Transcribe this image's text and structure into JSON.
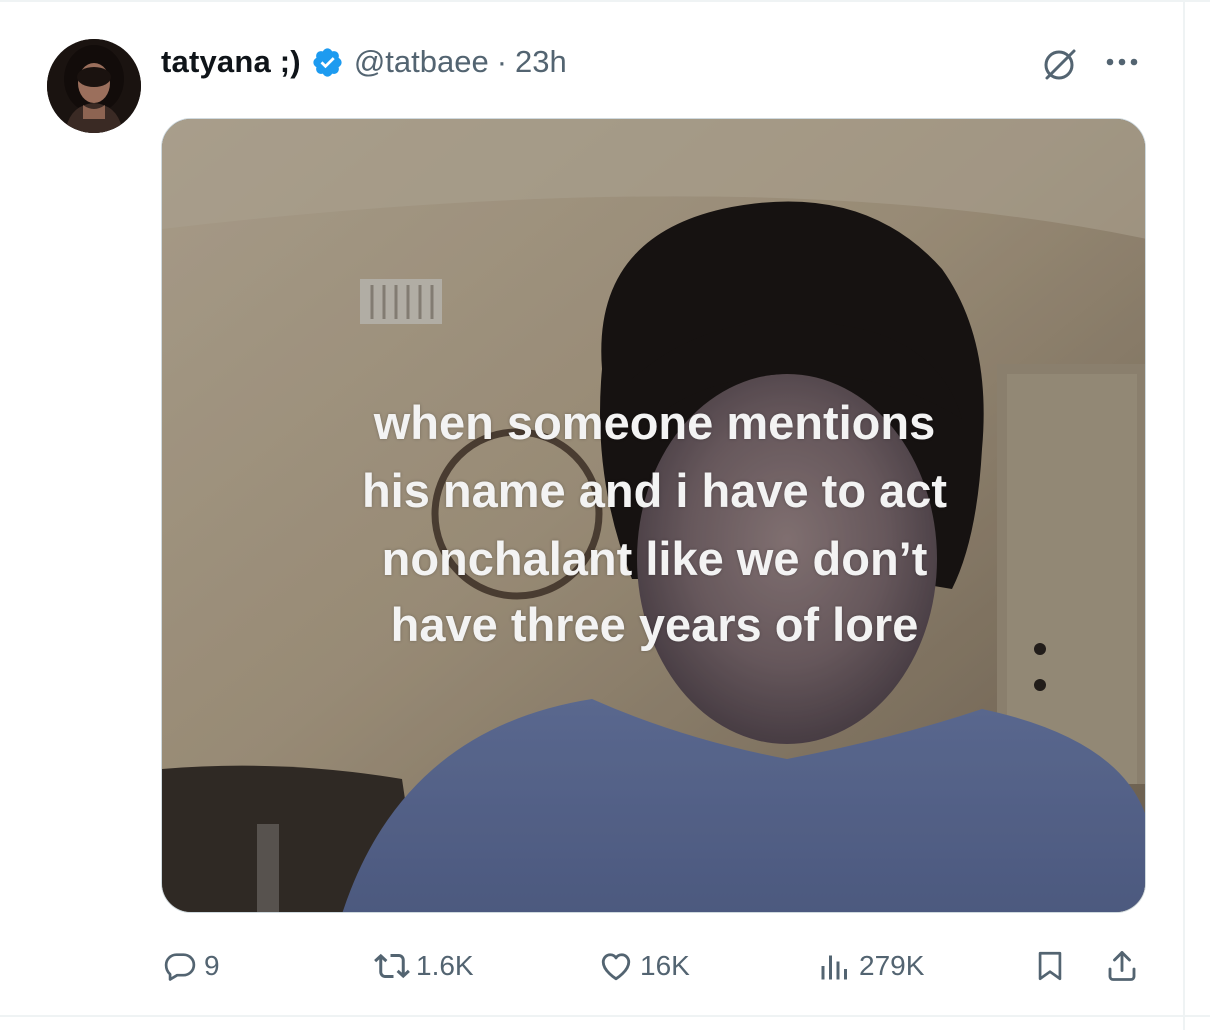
{
  "tweet": {
    "author": {
      "display_name": "tatyana ;)",
      "handle": "@tatbaee",
      "verified": true
    },
    "separator": "·",
    "time": "23h",
    "media_caption_lines": [
      "when someone mentions",
      "his name and i have to act",
      "nonchalant like we don’t",
      "have three years of lore"
    ],
    "actions": {
      "replies": "9",
      "reposts": "1.6K",
      "likes": "16K",
      "views": "279K"
    }
  },
  "icons": {
    "verified": "verified-badge-icon",
    "grok": "grok-icon",
    "more": "more-icon",
    "reply": "reply-icon",
    "repost": "repost-icon",
    "like": "like-icon",
    "views": "views-icon",
    "bookmark": "bookmark-icon",
    "share": "share-icon"
  },
  "colors": {
    "verified_blue": "#1d9bf0",
    "text_primary": "#0f1419",
    "text_secondary": "#536471",
    "divider": "#eff3f4"
  }
}
